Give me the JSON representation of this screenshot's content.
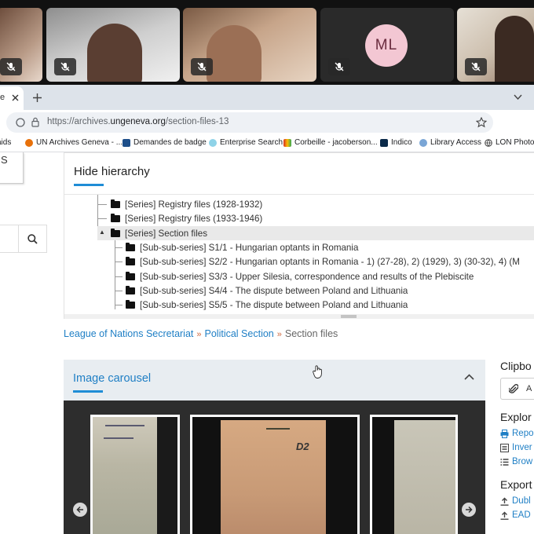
{
  "meeting": {
    "participant_initials": "ML"
  },
  "browser": {
    "tab_label": "e",
    "url_prefix": "https://archives.",
    "url_domain": "ungeneva.org",
    "url_path": "/section-files-13",
    "bookmarks": [
      "aids",
      "UN Archives Geneva - ...",
      "Demandes de badge",
      "Enterprise Search",
      "Corbeille - jacoberson...",
      "Indico",
      "Library Access",
      "LON Photos"
    ]
  },
  "page": {
    "left_card_text": "S",
    "hierarchy": {
      "title": "Hide hierarchy",
      "items": [
        "[Series] Registry files (1928-1932)",
        "[Series] Registry files (1933-1946)",
        "[Series] Section files",
        "[Sub-sub-series] S1/1 - Hungarian optants in Romania",
        "[Sub-sub-series] S2/2 - Hungarian optants in Romania - 1) (27-28), 2) (1929), 3) (30-32), 4) (M",
        "[Sub-sub-series] S3/3 - Upper Silesia, correspondence and results of the Plebiscite",
        "[Sub-sub-series] S4/4 - The dispute between Poland and Lithuania",
        "[Sub-sub-series] S5/5 - The dispute between Poland and Lithuania"
      ]
    },
    "breadcrumb": {
      "items": [
        "League of Nations Secretariat",
        "Political Section"
      ],
      "current": "Section files"
    },
    "carousel": {
      "title": "Image carousel",
      "doc_stamp": "D2"
    },
    "right": {
      "clipboard_title": "Clipbo",
      "clipboard_button": "A",
      "explore_title": "Explor",
      "explore_links": [
        "Repo",
        "Inver",
        "Brow"
      ],
      "export_title": "Export",
      "export_links": [
        "Dubl",
        "EAD"
      ]
    }
  }
}
